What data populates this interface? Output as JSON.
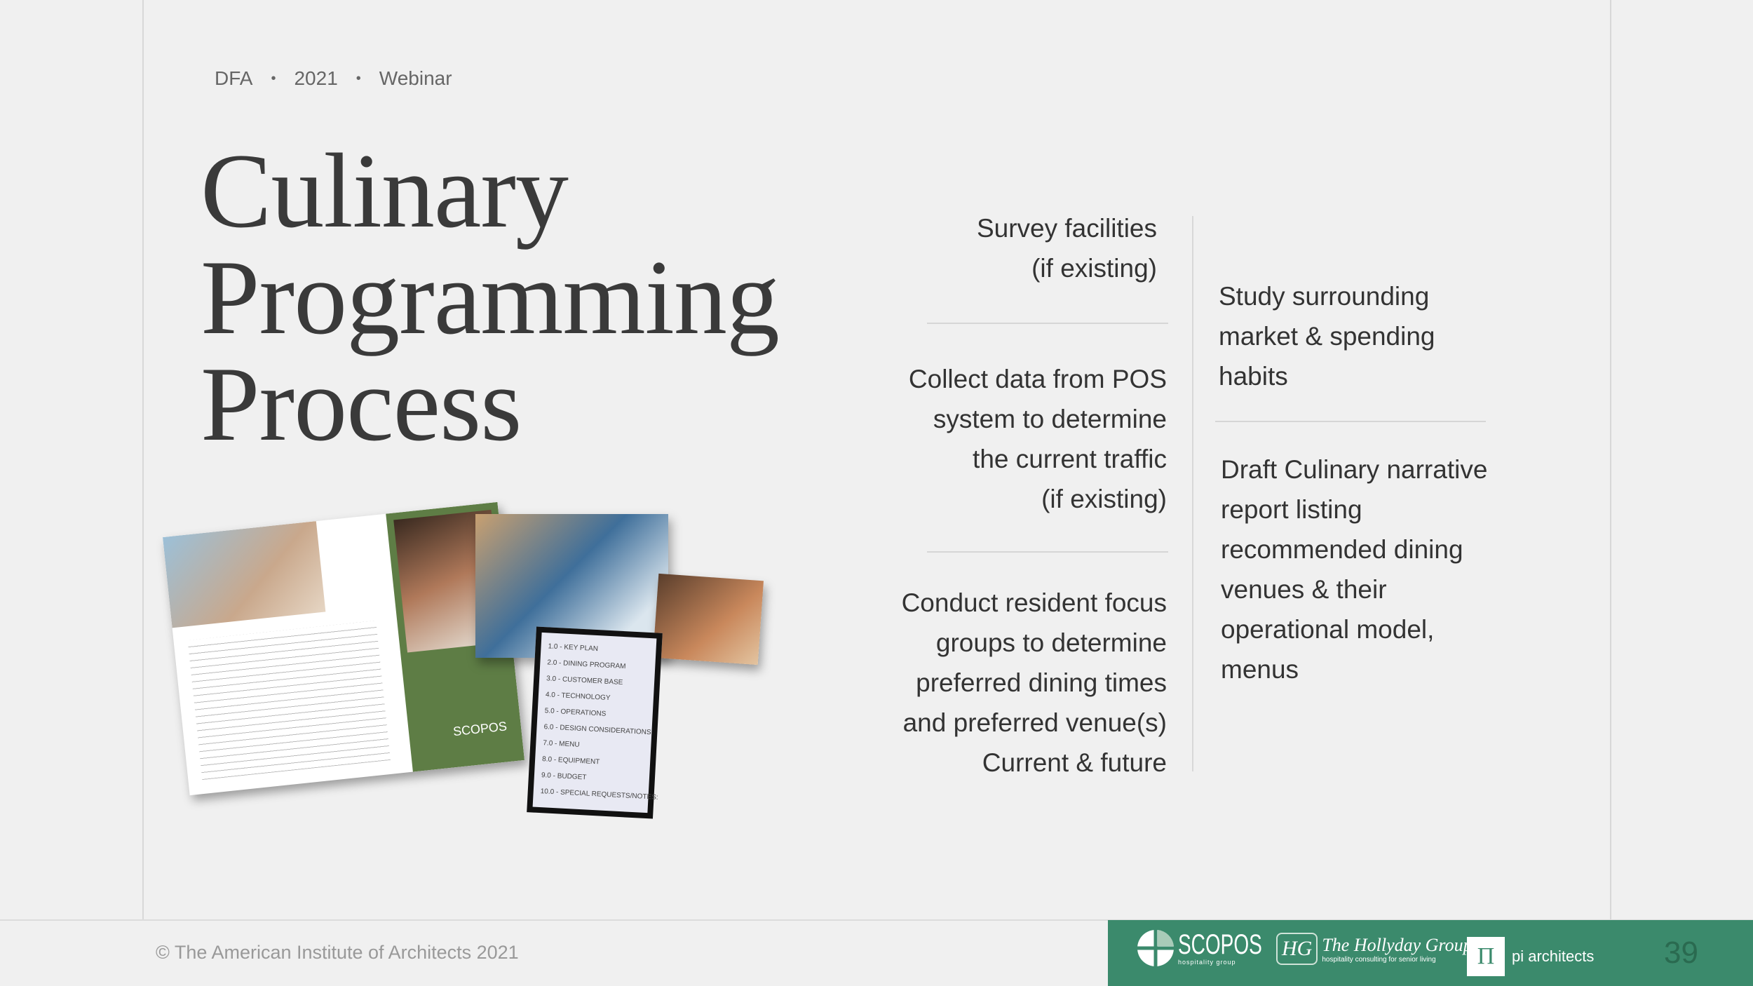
{
  "breadcrumb": {
    "items": [
      "DFA",
      "2021",
      "Webinar"
    ],
    "separator": "•"
  },
  "title": {
    "lines": [
      "Culinary",
      "Programming",
      "Process"
    ]
  },
  "middle_column": [
    {
      "lines": [
        "Survey facilities",
        "(if existing)"
      ]
    },
    {
      "lines": [
        "Collect data from POS",
        "system to determine",
        "the current traffic",
        "(if existing)"
      ]
    },
    {
      "lines": [
        "Conduct resident focus",
        "groups to determine",
        "preferred dining times",
        "and preferred venue(s)",
        "Current & future"
      ]
    }
  ],
  "right_column": [
    {
      "lines": [
        "Study surrounding",
        "market & spending",
        "habits"
      ]
    },
    {
      "lines": [
        "Draft Culinary narrative",
        "report listing",
        "recommended dining",
        "venues & their",
        "operational model,",
        "menus"
      ]
    }
  ],
  "collage": {
    "menu_items": [
      "1.0 - KEY PLAN",
      "2.0 - DINING PROGRAM",
      "3.0 - CUSTOMER BASE",
      "4.0 - TECHNOLOGY",
      "5.0 - OPERATIONS",
      "6.0 - DESIGN CONSIDERATIONS",
      "7.0 - MENU",
      "8.0 - EQUIPMENT",
      "9.0 - BUDGET",
      "10.0 - SPECIAL REQUESTS/NOTES:"
    ],
    "brochure_logo": "SCOPOS"
  },
  "footer": {
    "copyright": "© The American Institute of Architects 2021",
    "logos": {
      "scopos": "SCOPOS",
      "scopos_sub": "hospitality group",
      "hg_mark": "HG",
      "hg_name": "The Hollyday Group",
      "hg_sub": "hospitality consulting for senior living",
      "pi_mark": "Π",
      "pi_name": "pi architects"
    },
    "page_number": "39",
    "accent_color": "#3b8a6c"
  }
}
